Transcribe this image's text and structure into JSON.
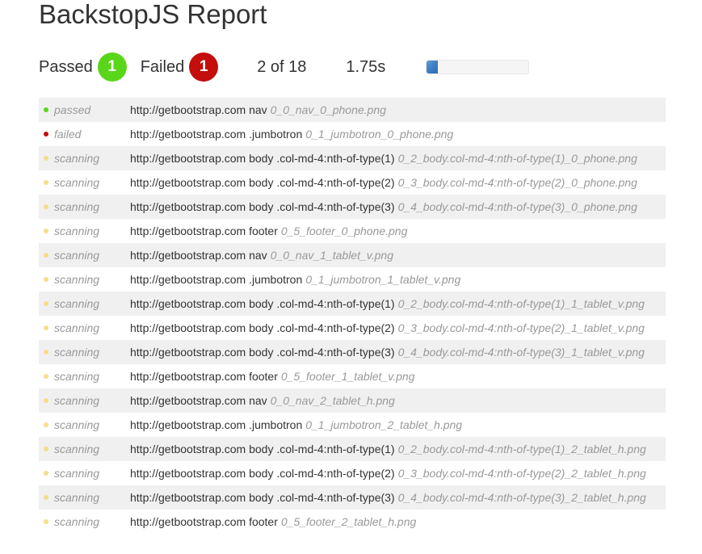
{
  "header": {
    "title": "BackstopJS Report"
  },
  "summary": {
    "passed_label": "Passed",
    "passed_count": "1",
    "failed_label": "Failed",
    "failed_count": "1",
    "progress_text": "2 of 18",
    "elapsed": "1.75s",
    "progress_fraction": 0.111,
    "colors": {
      "passed": "#59d61a",
      "failed": "#c40d0d",
      "scanning": "#f7dc8a",
      "progress": "#3d7fc4"
    }
  },
  "tests": [
    {
      "status": "passed",
      "desc": "http://getbootstrap.com nav",
      "file": "0_0_nav_0_phone.png"
    },
    {
      "status": "failed",
      "desc": "http://getbootstrap.com .jumbotron",
      "file": "0_1_jumbotron_0_phone.png"
    },
    {
      "status": "scanning",
      "desc": "http://getbootstrap.com body .col-md-4:nth-of-type(1)",
      "file": "0_2_body.col-md-4:nth-of-type(1)_0_phone.png"
    },
    {
      "status": "scanning",
      "desc": "http://getbootstrap.com body .col-md-4:nth-of-type(2)",
      "file": "0_3_body.col-md-4:nth-of-type(2)_0_phone.png"
    },
    {
      "status": "scanning",
      "desc": "http://getbootstrap.com body .col-md-4:nth-of-type(3)",
      "file": "0_4_body.col-md-4:nth-of-type(3)_0_phone.png"
    },
    {
      "status": "scanning",
      "desc": "http://getbootstrap.com footer",
      "file": "0_5_footer_0_phone.png"
    },
    {
      "status": "scanning",
      "desc": "http://getbootstrap.com nav",
      "file": "0_0_nav_1_tablet_v.png"
    },
    {
      "status": "scanning",
      "desc": "http://getbootstrap.com .jumbotron",
      "file": "0_1_jumbotron_1_tablet_v.png"
    },
    {
      "status": "scanning",
      "desc": "http://getbootstrap.com body .col-md-4:nth-of-type(1)",
      "file": "0_2_body.col-md-4:nth-of-type(1)_1_tablet_v.png"
    },
    {
      "status": "scanning",
      "desc": "http://getbootstrap.com body .col-md-4:nth-of-type(2)",
      "file": "0_3_body.col-md-4:nth-of-type(2)_1_tablet_v.png"
    },
    {
      "status": "scanning",
      "desc": "http://getbootstrap.com body .col-md-4:nth-of-type(3)",
      "file": "0_4_body.col-md-4:nth-of-type(3)_1_tablet_v.png"
    },
    {
      "status": "scanning",
      "desc": "http://getbootstrap.com footer",
      "file": "0_5_footer_1_tablet_v.png"
    },
    {
      "status": "scanning",
      "desc": "http://getbootstrap.com nav",
      "file": "0_0_nav_2_tablet_h.png"
    },
    {
      "status": "scanning",
      "desc": "http://getbootstrap.com .jumbotron",
      "file": "0_1_jumbotron_2_tablet_h.png"
    },
    {
      "status": "scanning",
      "desc": "http://getbootstrap.com body .col-md-4:nth-of-type(1)",
      "file": "0_2_body.col-md-4:nth-of-type(1)_2_tablet_h.png"
    },
    {
      "status": "scanning",
      "desc": "http://getbootstrap.com body .col-md-4:nth-of-type(2)",
      "file": "0_3_body.col-md-4:nth-of-type(2)_2_tablet_h.png"
    },
    {
      "status": "scanning",
      "desc": "http://getbootstrap.com body .col-md-4:nth-of-type(3)",
      "file": "0_4_body.col-md-4:nth-of-type(3)_2_tablet_h.png"
    },
    {
      "status": "scanning",
      "desc": "http://getbootstrap.com footer",
      "file": "0_5_footer_2_tablet_h.png"
    }
  ]
}
